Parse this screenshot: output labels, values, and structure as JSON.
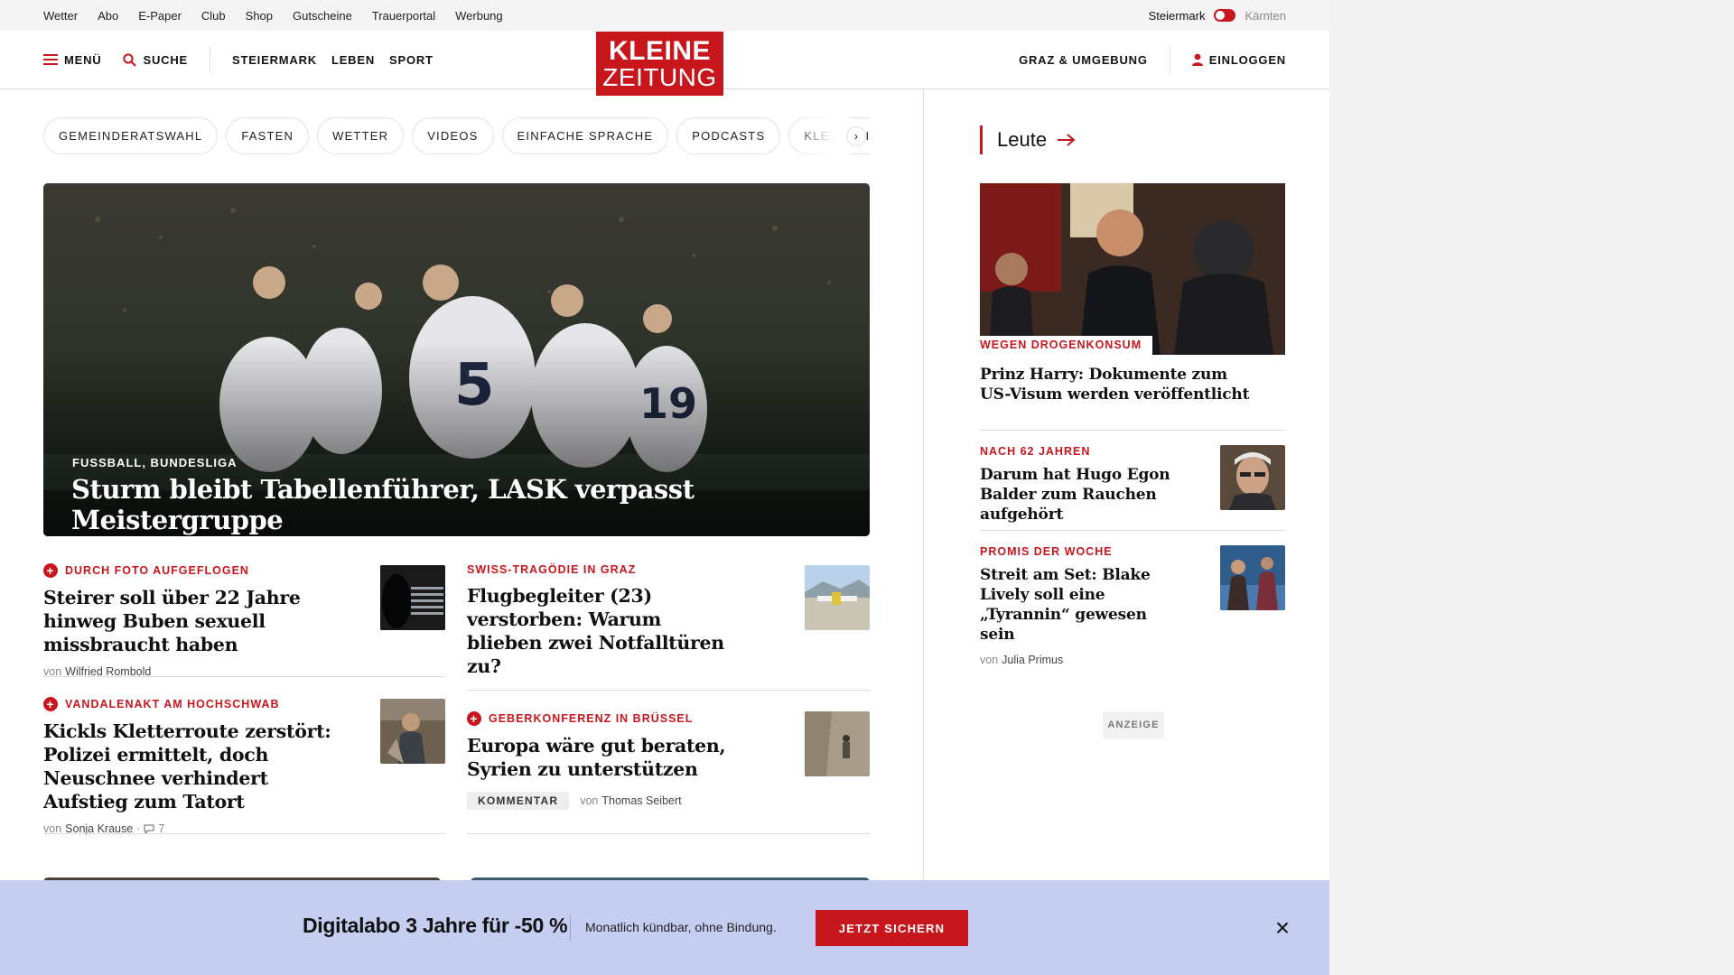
{
  "utility": {
    "links": [
      "Wetter",
      "Abo",
      "E-Paper",
      "Club",
      "Shop",
      "Gutscheine",
      "Trauerportal",
      "Werbung"
    ],
    "region_active": "Steiermark",
    "region_inactive": "Kärnten"
  },
  "nav": {
    "menu": "MENÜ",
    "search": "SUCHE",
    "sections": [
      "STEIERMARK",
      "LEBEN",
      "SPORT"
    ],
    "local": "GRAZ & UMGEBUNG",
    "login": "EINLOGGEN"
  },
  "logo": {
    "line1": "KLEINE",
    "line2": "ZEITUNG"
  },
  "chips": [
    "GEMEINDERATSWAHL",
    "FASTEN",
    "WETTER",
    "VIDEOS",
    "EINFACHE SPRACHE",
    "PODCASTS",
    "KLEINE KINDE"
  ],
  "hero": {
    "kicker": "FUSSBALL, BUNDESLIGA",
    "title": "Sturm bleibt Tabellenführer, LASK verpasst Meistergruppe"
  },
  "articles": [
    {
      "kicker": "DURCH FOTO AUFGEFLOGEN",
      "title": "Steirer soll über 22 Jahre hinweg Buben sexuell missbraucht haben",
      "by": "von",
      "author": "Wilfried Rombold"
    },
    {
      "kicker": "SWISS-TRAGÖDIE IN GRAZ",
      "title": "Flugbegleiter (23) verstorben: Warum blieben zwei Notfalltüren zu?"
    },
    {
      "kicker": "VANDALENAKT AM HOCHSCHWAB",
      "title": "Kickls Kletterroute zerstört: Polizei ermittelt, doch Neuschnee verhindert Aufstieg zum Tatort",
      "by": "von",
      "author": "Sonja Krause",
      "comments": "7"
    },
    {
      "kicker": "GEBERKONFERENZ IN BRÜSSEL",
      "title": "Europa wäre gut beraten, Syrien zu unterstützen",
      "badge": "KOMMENTAR",
      "by": "von",
      "author": "Thomas Seibert"
    }
  ],
  "sidebar": {
    "heading": "Leute",
    "items": [
      {
        "kicker": "WEGEN DROGENKONSUM",
        "title": "Prinz Harry: Dokumente zum US-Visum werden veröffentlicht"
      },
      {
        "kicker": "NACH 62 JAHREN",
        "title": "Darum hat Hugo Egon Balder zum Rauchen aufgehört"
      },
      {
        "kicker": "PROMIS DER WOCHE",
        "title": "Streit am Set: Blake Lively soll eine „Tyrannin“ gewesen sein",
        "by": "von",
        "author": "Julia Primus"
      }
    ]
  },
  "ad": {
    "label": "ANZEIGE"
  },
  "promo": {
    "title": "Digitalabo 3 Jahre für -50 %",
    "subtitle": "Monatlich kündbar, ohne Bindung.",
    "button": "JETZT SICHERN"
  },
  "colors": {
    "brand": "#c8161d",
    "promo_bg": "#c5cdf0"
  }
}
